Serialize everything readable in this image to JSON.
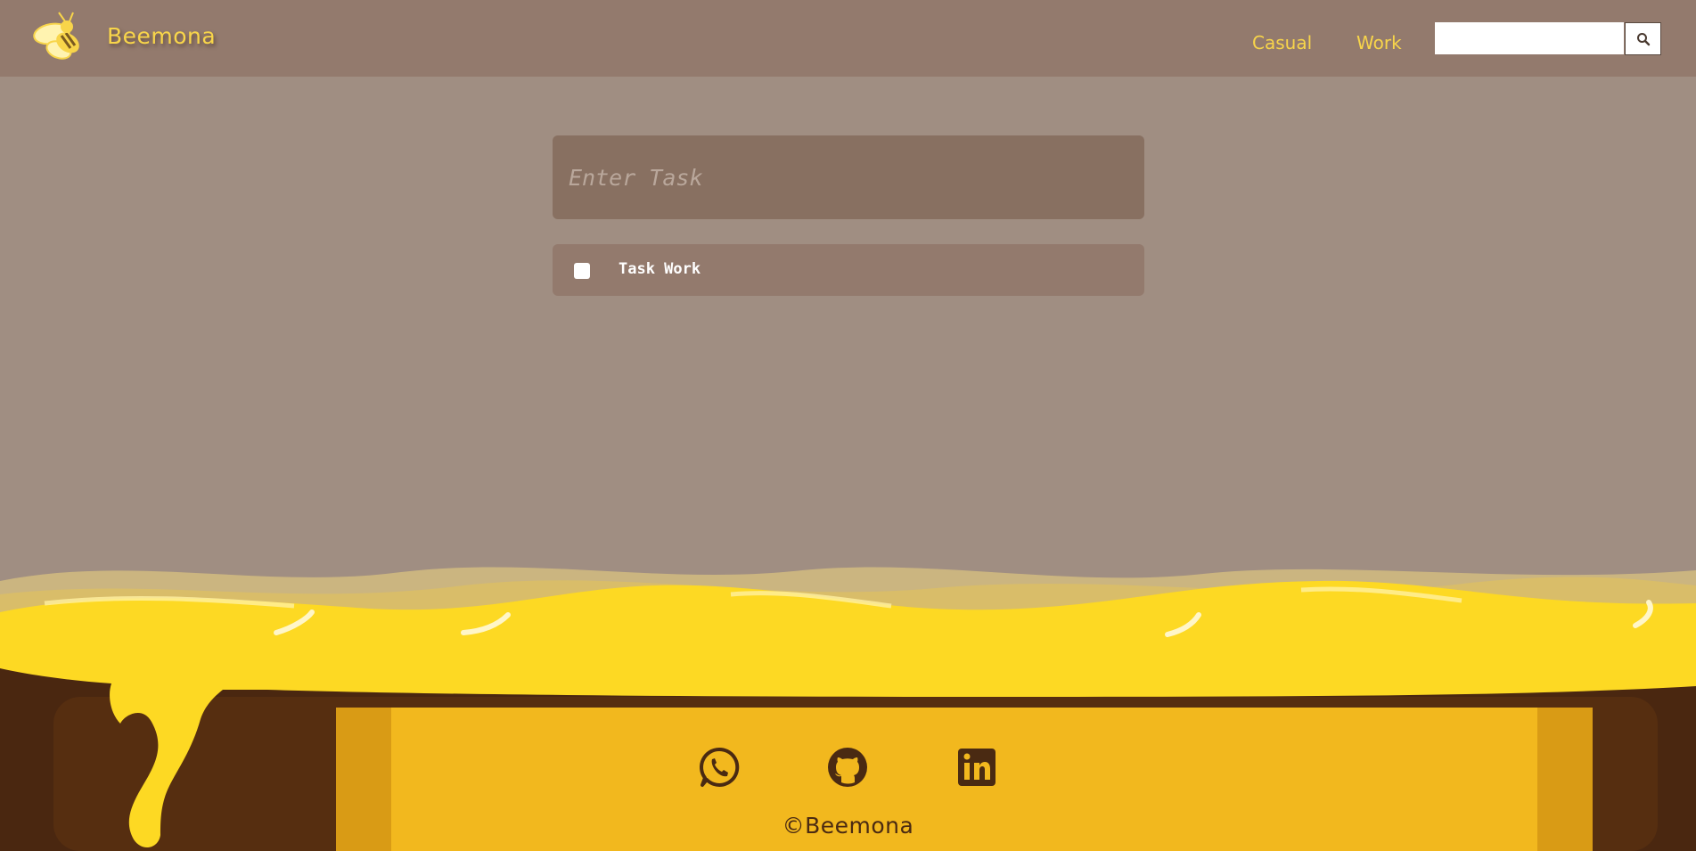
{
  "navbar": {
    "brand": "Beemona",
    "links": [
      "Casual",
      "Work"
    ],
    "search": {
      "value": "",
      "placeholder": ""
    },
    "search_icon": "search-icon",
    "logo_icon": "bee-logo"
  },
  "task_form": {
    "input_placeholder": "Enter Task",
    "input_value": ""
  },
  "tasks": [
    {
      "label": "Task Work",
      "checked": false
    }
  ],
  "footer": {
    "social_icons": [
      "whatsapp-icon",
      "github-icon",
      "linkedin-icon"
    ],
    "copyright": "©Beemona"
  },
  "colors": {
    "page_bg": "#a08e82",
    "navbar_bg": "#937a6d",
    "accent_yellow": "#f8d54a",
    "honey": "#fdd923",
    "pot_dark": "#562e10",
    "pot_label": "#f2b81e"
  }
}
